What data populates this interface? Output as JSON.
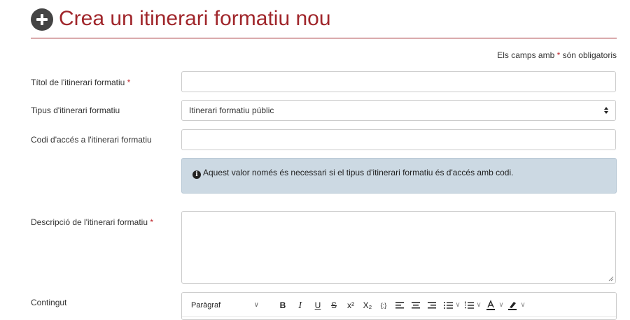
{
  "header": {
    "title": "Crea un itinerari formatiu nou"
  },
  "form": {
    "required_note_prefix": "Els camps amb ",
    "required_star": "*",
    "required_note_suffix": " són obligatoris",
    "fields": {
      "title": {
        "label": "Títol de l'itinerari formatiu ",
        "required": "*",
        "value": ""
      },
      "type": {
        "label": "Tipus d'itinerari formatiu",
        "selected": "Itinerari formatiu públic"
      },
      "access_code": {
        "label": "Codi d'accés a l'itinerari formatiu",
        "value": "",
        "info": "Aquest valor només és necessari si el tipus d'itinerari formatiu és d'accés amb codi."
      },
      "description": {
        "label": "Descripció de l'itinerari formatiu ",
        "required": "*",
        "value": ""
      },
      "content": {
        "label": "Contingut"
      }
    }
  },
  "editor": {
    "block_format": "Paràgraf",
    "buttons": {
      "bold": "B",
      "italic": "I",
      "underline": "U",
      "strike": "S",
      "superscript": "x²",
      "subscript": "X₂",
      "code": "{;}",
      "chevron": "∨"
    }
  },
  "colors": {
    "accent": "#a0262b",
    "required_star": "#c0282e",
    "info_background": "#ccd9e3"
  },
  "icons": {
    "header": "plus-circle-icon",
    "info": "info-circle-icon",
    "select": "select-arrows-icon"
  }
}
